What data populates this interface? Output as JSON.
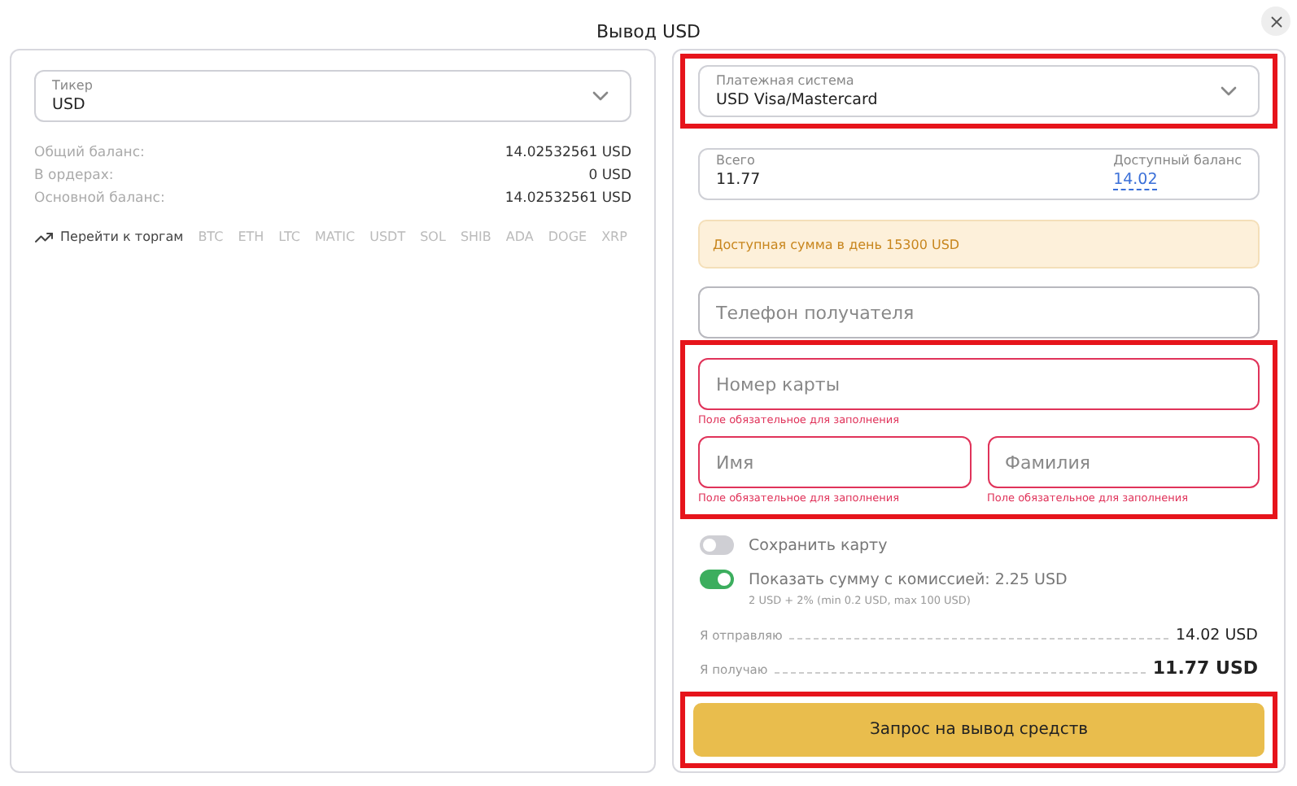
{
  "title": "Вывод USD",
  "ticker": {
    "label": "Тикер",
    "value": "USD"
  },
  "balances": [
    {
      "label": "Общий баланс:",
      "value": "14.02532561 USD"
    },
    {
      "label": "В ордерах:",
      "value": "0 USD"
    },
    {
      "label": "Основной баланс:",
      "value": "14.02532561 USD"
    }
  ],
  "trade": {
    "label": "Перейти к торгам",
    "tickers": [
      "BTC",
      "ETH",
      "LTC",
      "MATIC",
      "USDT",
      "SOL",
      "SHIB",
      "ADA",
      "DOGE",
      "XRP"
    ]
  },
  "payment": {
    "label": "Платежная система",
    "value": "USD Visa/Mastercard",
    "highlighted": true
  },
  "amount": {
    "label": "Всего",
    "value": "11.77",
    "balance_label": "Доступный баланс",
    "balance": "14.02"
  },
  "notice": "Доступная сумма в день 15300 USD",
  "phone": {
    "placeholder": "Телефон получателя"
  },
  "card_group": {
    "highlighted": true,
    "fields": [
      {
        "placeholder": "Номер карты",
        "error": "Поле обязательное для заполнения"
      },
      {
        "placeholder": "Имя",
        "error": "Поле обязательное для заполнения"
      },
      {
        "placeholder": "Фамилия",
        "error": "Поле обязательное для заполнения"
      }
    ]
  },
  "toggles": [
    {
      "label": "Сохранить карту",
      "on": false
    },
    {
      "label": "Показать сумму с комиссией: 2.25 USD",
      "on": true,
      "note": "2 USD + 2% (min 0.2 USD, max 100 USD)"
    }
  ],
  "summary": [
    {
      "label": "Я отправляю",
      "value": "14.02 USD",
      "emphasis": false
    },
    {
      "label": "Я получаю",
      "value": "11.77 USD",
      "emphasis": true
    }
  ],
  "submit": {
    "label": "Запрос на вывод средств",
    "highlighted": true
  }
}
